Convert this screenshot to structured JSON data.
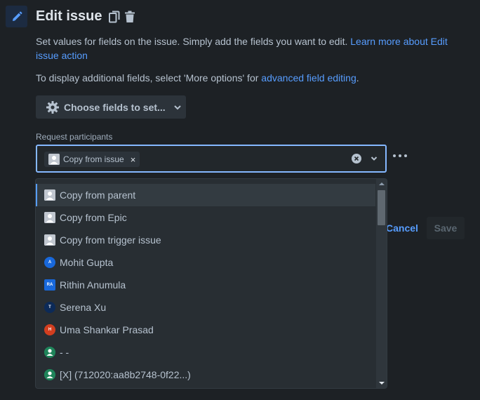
{
  "header": {
    "title": "Edit issue",
    "icons": [
      "pencil-icon",
      "copy-icon",
      "trash-icon"
    ]
  },
  "description": {
    "text": "Set values for fields on the issue. Simply add the fields you want to edit. ",
    "link": "Learn more about Edit issue action"
  },
  "more_info": {
    "prefix": "To display additional fields, select 'More options' for ",
    "link": "advanced field editing",
    "suffix": "."
  },
  "choose_fields": {
    "label": "Choose fields to set...",
    "icon": "gear-icon"
  },
  "field": {
    "label": "Request participants",
    "selected_tag": "Copy from issue",
    "tag_remove": "×"
  },
  "actions": {
    "cancel": "Cancel",
    "save": "Save"
  },
  "options": [
    {
      "label": "Copy from parent",
      "avatar": "square",
      "initials": ""
    },
    {
      "label": "Copy from Epic",
      "avatar": "square",
      "initials": ""
    },
    {
      "label": "Copy from trigger issue",
      "avatar": "square",
      "initials": ""
    },
    {
      "label": "Mohit Gupta",
      "avatar": "circle",
      "initials": "A",
      "color": "#1868db"
    },
    {
      "label": "Rithin Anumula",
      "avatar": "rsq",
      "initials": "RA",
      "color": "#1868db"
    },
    {
      "label": "Serena Xu",
      "avatar": "circle",
      "initials": "T",
      "color": "#0c2a58"
    },
    {
      "label": "Uma Shankar Prasad",
      "avatar": "circle",
      "initials": "H",
      "color": "#d23e1f"
    },
    {
      "label": "- -",
      "avatar": "person",
      "initials": "",
      "color": "#1f845a"
    },
    {
      "label": "[X] (712020:aa8b2748-0f22...)",
      "avatar": "person",
      "initials": "",
      "color": "#1f845a"
    }
  ],
  "colors": {
    "background": "#1d2125",
    "accent": "#579dff",
    "focus_border": "#85b8ff"
  }
}
